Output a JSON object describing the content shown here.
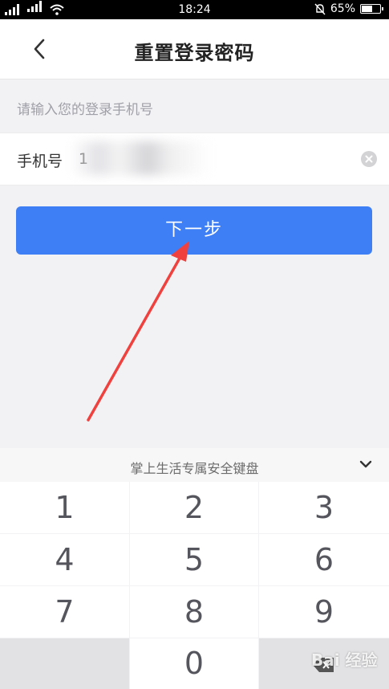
{
  "status_bar": {
    "time": "18:24",
    "network": "4G",
    "battery": "65%",
    "battery_level": 0.65
  },
  "header": {
    "title": "重置登录密码"
  },
  "form": {
    "hint": "请输入您的登录手机号",
    "phone_label": "手机号",
    "phone_value": "1"
  },
  "next_button": {
    "label": "下一步"
  },
  "annotation": {
    "arrow_color": "#f0413e"
  },
  "colors": {
    "primary": "#3f7ff5",
    "background": "#f2f2f4"
  },
  "keyboard": {
    "title": "掌上生活专属安全键盘",
    "keys": [
      "1",
      "2",
      "3",
      "4",
      "5",
      "6",
      "7",
      "8",
      "9",
      "0"
    ]
  },
  "watermark": "Bai 经验"
}
